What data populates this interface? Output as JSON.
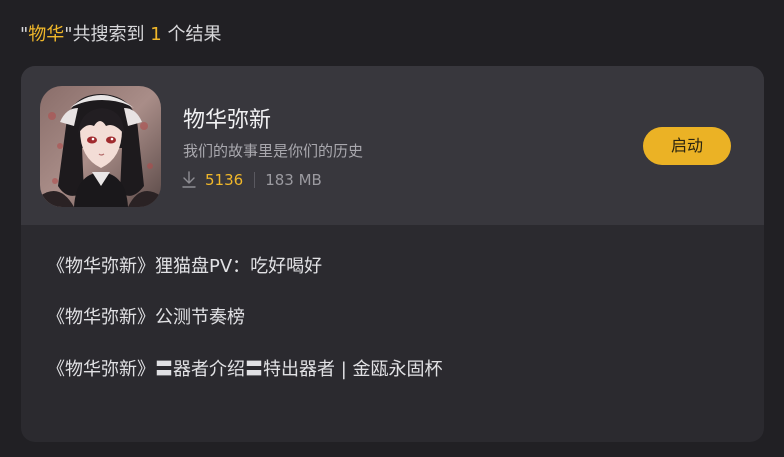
{
  "search_summary": {
    "quote_open": "\"",
    "query": "物华",
    "mid_text": "\"共搜索到 ",
    "count": "1",
    "suffix": " 个结果"
  },
  "app": {
    "name": "物华弥新",
    "tagline": "我们的故事里是你们的历史",
    "download_count": "5136",
    "size": "183 MB",
    "launch_label": "启动",
    "icon": "character-portrait"
  },
  "related_items": [
    {
      "title": "《物华弥新》狸猫盘PV：吃好喝好"
    },
    {
      "title": "《物华弥新》公测节奏榜"
    },
    {
      "title": "《物华弥新》〓器者介绍〓特出器者 | 金瓯永固杯"
    }
  ],
  "colors": {
    "accent": "#f0b72a",
    "button": "#ebb225",
    "background": "#212024",
    "card": "#2b2a2f",
    "card_header": "#38373d"
  }
}
